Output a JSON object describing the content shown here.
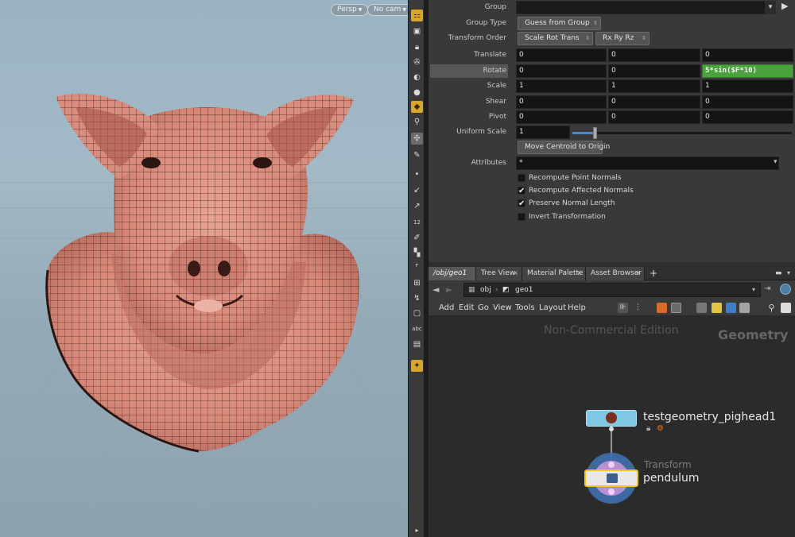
{
  "viewport": {
    "camera_mode": "Persp",
    "camera": "No cam"
  },
  "toolbar": {
    "icons": [
      "display-options-icon",
      "snapshot-icon",
      "lock-camera-icon",
      "ghost-icon",
      "shading-icon",
      "light-icon",
      "select-icon",
      "handle-icon",
      "display-icon",
      "visualize-icon",
      "point-icon",
      "normal-icon",
      "pin-icon",
      "number-icon",
      "brush-icon",
      "texture-icon",
      "border-icon",
      "vertex-icon",
      "uv-icon",
      "object-icon",
      "abc-label",
      "flipbook-icon",
      "light-bulb-icon"
    ],
    "text_label": "abc",
    "number_label": "12"
  },
  "params": {
    "group_label": "Group",
    "group_value": "",
    "group_type_label": "Group Type",
    "group_type_value": "Guess from Group",
    "transform_order_label": "Transform Order",
    "transform_order_value": "Scale Rot Trans",
    "rotate_order_value": "Rx Ry Rz",
    "translate_label": "Translate",
    "translate": [
      "0",
      "0",
      "0"
    ],
    "rotate_label": "Rotate",
    "rotate": [
      "0",
      "0",
      "5*sin($F*10)"
    ],
    "scale_label": "Scale",
    "scale": [
      "1",
      "1",
      "1"
    ],
    "shear_label": "Shear",
    "shear": [
      "0",
      "0",
      "0"
    ],
    "pivot_label": "Pivot",
    "pivot": [
      "0",
      "0",
      "0"
    ],
    "uniform_scale_label": "Uniform Scale",
    "uniform_scale_value": "1",
    "uniform_scale_level": 0.1,
    "move_centroid_label": "Move Centroid to Origin",
    "attributes_label": "Attributes",
    "attributes_value": "*",
    "checkboxes": [
      {
        "label": "Recompute Point Normals",
        "checked": false
      },
      {
        "label": "Recompute Affected Normals",
        "checked": true
      },
      {
        "label": "Preserve Normal Length",
        "checked": true
      },
      {
        "label": "Invert Transformation",
        "checked": false
      }
    ]
  },
  "pane_tabs": [
    {
      "label": "/obj/geo1",
      "active": true
    },
    {
      "label": "Tree View",
      "active": false
    },
    {
      "label": "Material Palette",
      "active": false
    },
    {
      "label": "Asset Browser",
      "active": false
    }
  ],
  "path": {
    "root": "obj",
    "node": "geo1"
  },
  "menu": [
    "Add",
    "Edit",
    "Go",
    "View",
    "Tools",
    "Layout",
    "Help"
  ],
  "network": {
    "watermark": "Non-Commercial Edition",
    "context_label": "Geometry",
    "nodes": [
      {
        "name": "testgeometry_pighead1",
        "type": ""
      },
      {
        "name": "pendulum",
        "type": "Transform"
      }
    ]
  },
  "colors": {
    "expression_green": "#4aa23c",
    "node_cyan": "#7ec8e3",
    "node_selected_yellow": "#f5c518",
    "slider_blue": "#4f86c6",
    "toolbar_highlight": "#d7a62a"
  }
}
